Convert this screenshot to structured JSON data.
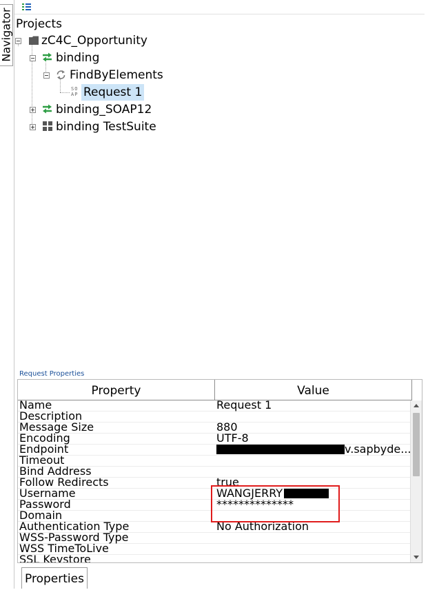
{
  "navigator": {
    "tab_label": "Navigator"
  },
  "toolbar": {
    "menu_icon": "list-menu-icon",
    "accent": "#1c5fb8"
  },
  "tree": {
    "root_label": "Projects",
    "project": {
      "label": "zC4C_Opportunity",
      "icon": "folder-icon"
    },
    "binding": {
      "label": "binding",
      "icon": "interface-arrows-icon",
      "color": "#2e9e45"
    },
    "operation": {
      "label": "FindByElements",
      "icon": "operation-refresh-icon"
    },
    "request": {
      "label": "Request 1",
      "icon": "soap-icon",
      "icon_text_top": "SO",
      "icon_text_bottom": "AP"
    },
    "binding_soap12": {
      "label": "binding_SOAP12",
      "icon": "interface-arrows-icon"
    },
    "testsuite": {
      "label": "binding TestSuite",
      "icon": "testsuite-grid-icon"
    }
  },
  "request_properties": {
    "caption": "Request Properties",
    "columns": {
      "property": "Property",
      "value": "Value"
    },
    "rows": [
      {
        "property": "Name",
        "value": "Request 1"
      },
      {
        "property": "Description",
        "value": ""
      },
      {
        "property": "Message Size",
        "value": "880"
      },
      {
        "property": "Encoding",
        "value": "UTF-8"
      },
      {
        "property": "Endpoint",
        "value": "v.sapbyde..."
      },
      {
        "property": "Timeout",
        "value": ""
      },
      {
        "property": "Bind Address",
        "value": ""
      },
      {
        "property": "Follow Redirects",
        "value": "true"
      },
      {
        "property": "Username",
        "value": "WANGJERRY"
      },
      {
        "property": "Password",
        "value": "**************"
      },
      {
        "property": "Domain",
        "value": ""
      },
      {
        "property": "Authentication Type",
        "value": "No Authorization"
      },
      {
        "property": "WSS-Password Type",
        "value": ""
      },
      {
        "property": "WSS TimeToLive",
        "value": ""
      },
      {
        "property": "SSL Keystore",
        "value": ""
      }
    ],
    "highlight_color": "#e01b1b"
  },
  "bottom_tabs": {
    "properties": "Properties"
  }
}
